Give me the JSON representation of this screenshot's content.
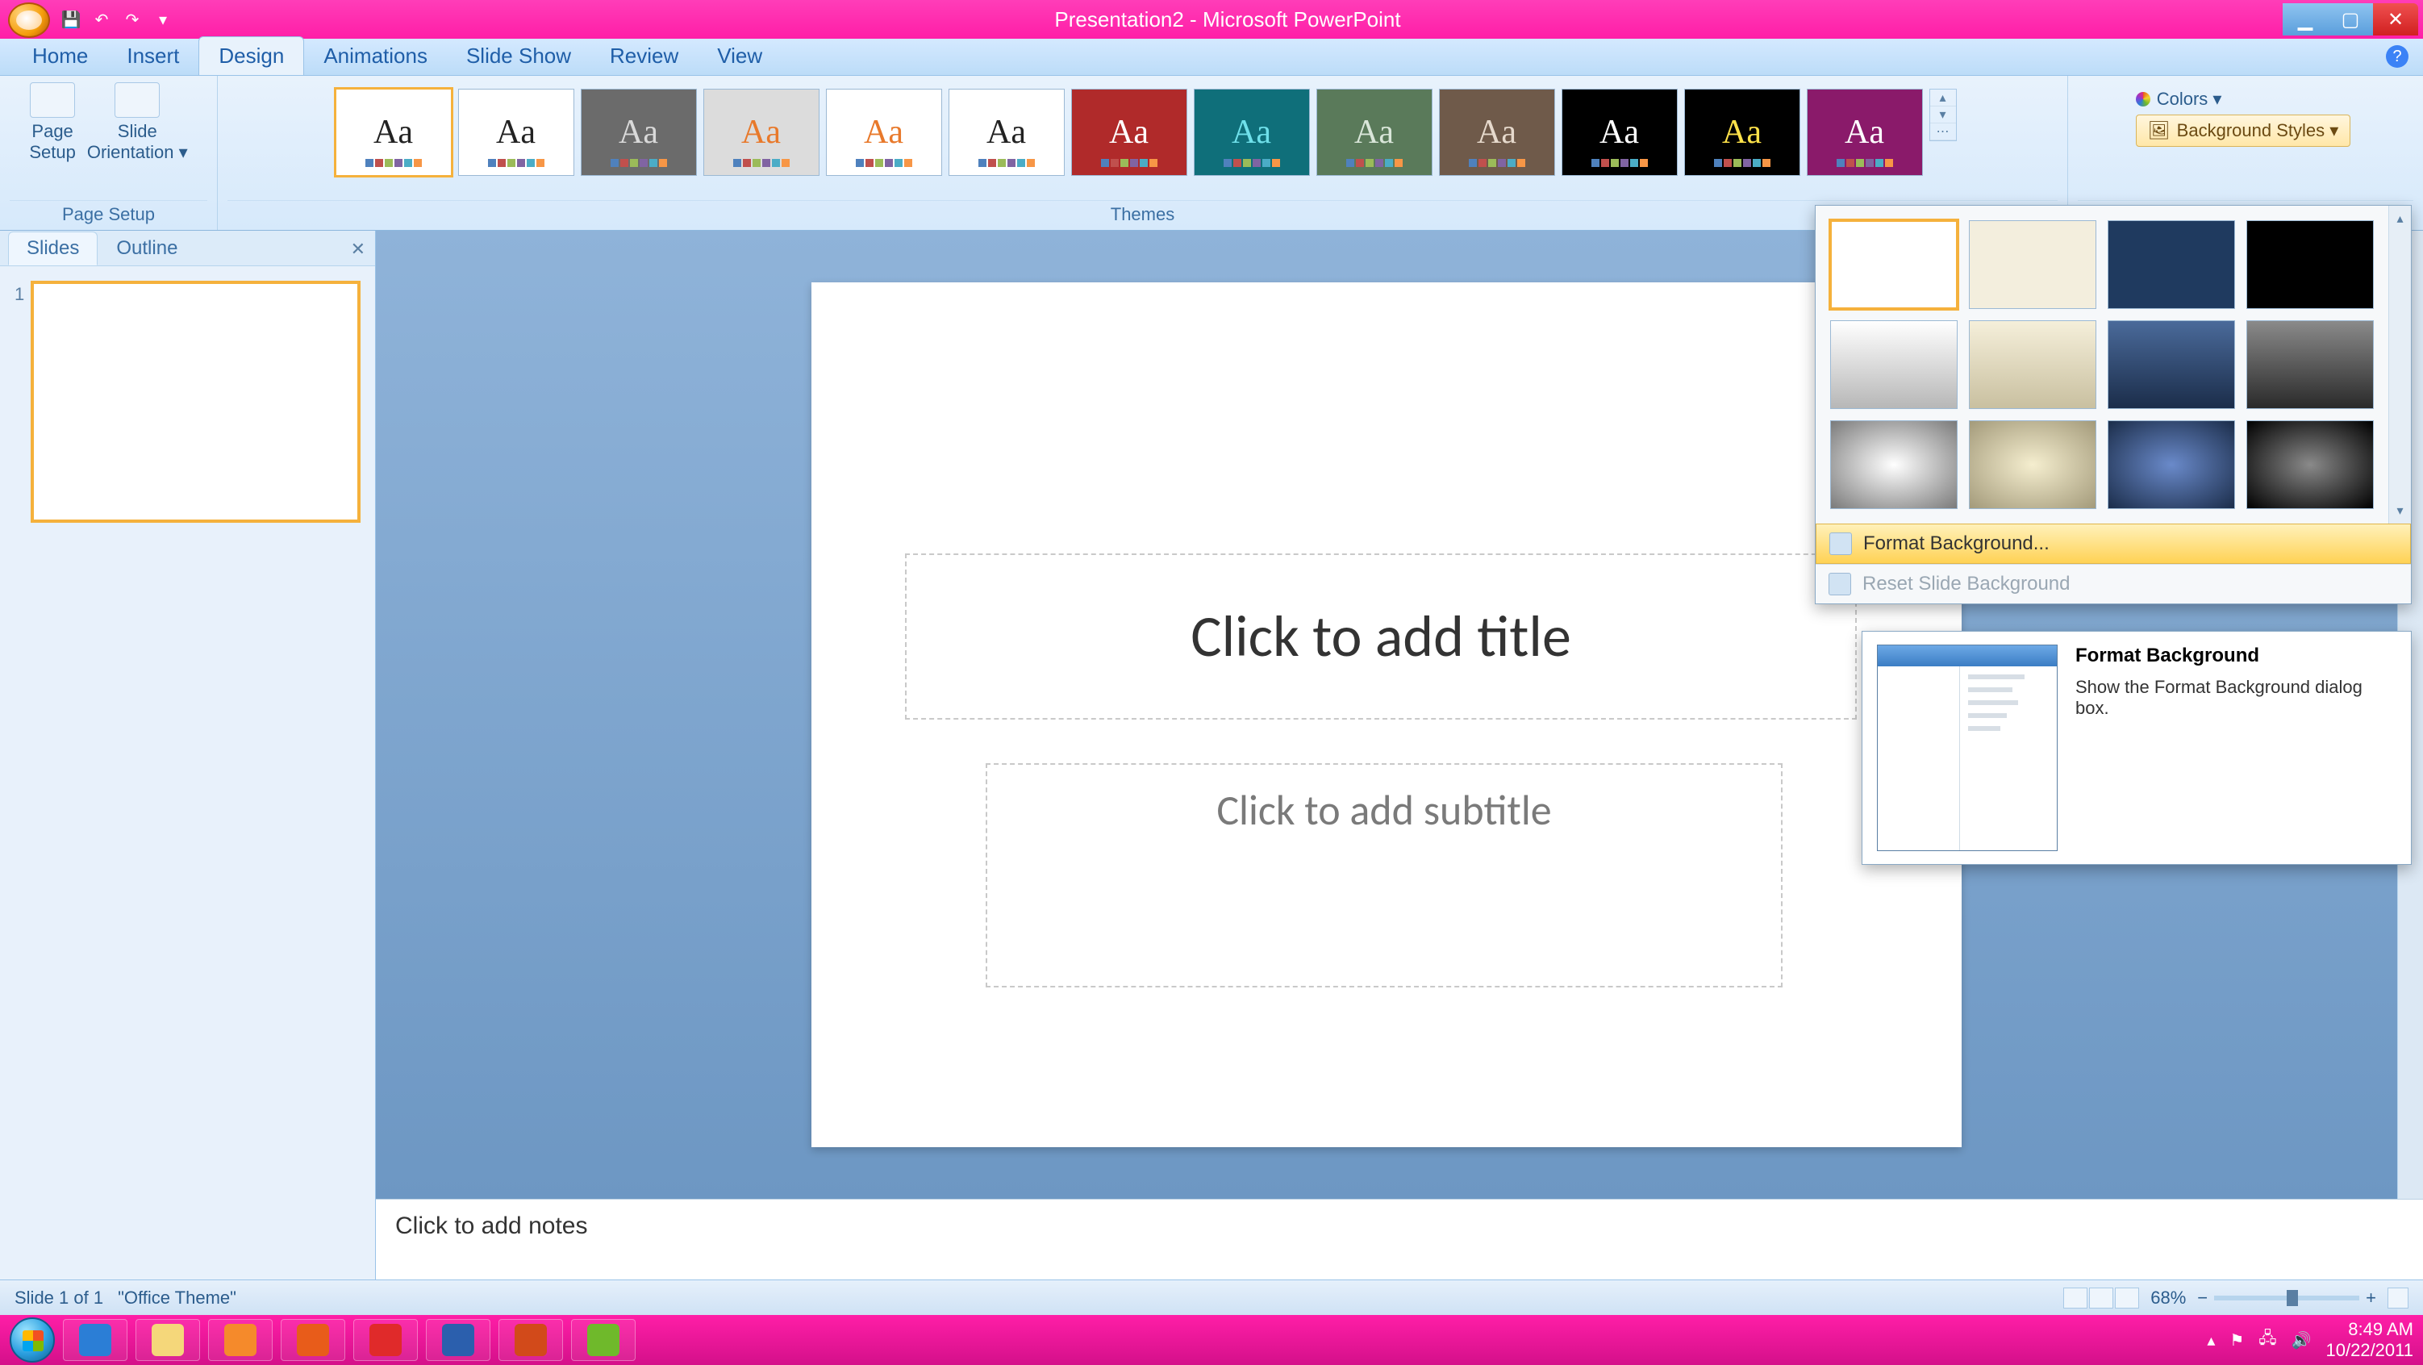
{
  "title": "Presentation2 - Microsoft PowerPoint",
  "tabs": [
    "Home",
    "Insert",
    "Design",
    "Animations",
    "Slide Show",
    "Review",
    "View"
  ],
  "active_tab_index": 2,
  "groups": {
    "page_setup": {
      "label": "Page Setup",
      "buttons": {
        "page_setup": "Page\nSetup",
        "orientation": "Slide\nOrientation ▾"
      }
    },
    "themes": {
      "label": "Themes"
    }
  },
  "theme_controls": {
    "colors": "Colors ▾",
    "bg_styles": "Background Styles ▾"
  },
  "themes": [
    {
      "bg": "#ffffff",
      "fg": "#222222",
      "name": "office"
    },
    {
      "bg": "#ffffff",
      "fg": "#222222",
      "name": "apex"
    },
    {
      "bg": "#6b6b6b",
      "fg": "#d9d9d9",
      "name": "aspect"
    },
    {
      "bg": "#dcdcdc",
      "fg": "#e8792b",
      "name": "civic"
    },
    {
      "bg": "#ffffff",
      "fg": "#e8792b",
      "name": "concourse"
    },
    {
      "bg": "#ffffff",
      "fg": "#222222",
      "name": "equity"
    },
    {
      "bg": "#b02a2a",
      "fg": "#ffffff",
      "name": "flow"
    },
    {
      "bg": "#0f6f7a",
      "fg": "#6fe0ea",
      "name": "foundry"
    },
    {
      "bg": "#5a7a5a",
      "fg": "#d9e6d9",
      "name": "median"
    },
    {
      "bg": "#6f5a4a",
      "fg": "#e6d9cc",
      "name": "metro"
    },
    {
      "bg": "#000000",
      "fg": "#ffffff",
      "name": "module"
    },
    {
      "bg": "#000000",
      "fg": "#ffe24a",
      "name": "opulent"
    },
    {
      "bg": "#8a1a6a",
      "fg": "#ffffff",
      "name": "oriel"
    }
  ],
  "swatches": [
    "#4f81bd",
    "#c0504d",
    "#9bbb59",
    "#8064a2",
    "#4bacc6",
    "#f79646"
  ],
  "bg_panel": {
    "styles": [
      {
        "bg": "#ffffff"
      },
      {
        "bg": "#f3eedd"
      },
      {
        "bg": "#1f3a5f"
      },
      {
        "bg": "#000000"
      },
      {
        "bg": "linear-gradient(#ffffff,#b7b7b7)"
      },
      {
        "bg": "linear-gradient(#f5efda,#c9c0a0)"
      },
      {
        "bg": "linear-gradient(#4a6a9a,#1b2d4a)"
      },
      {
        "bg": "linear-gradient(#8a8a8a,#2a2a2a)"
      },
      {
        "bg": "radial-gradient(#ffffff,#7a7a7a)"
      },
      {
        "bg": "radial-gradient(#f5eecf,#a39a7a)"
      },
      {
        "bg": "radial-gradient(#6a8aca,#1b2d4a)"
      },
      {
        "bg": "radial-gradient(#8a8a8a,#000000)"
      }
    ],
    "format_bg": "Format Background...",
    "reset_bg": "Reset Slide Background"
  },
  "tooltip": {
    "title": "Format Background",
    "body": "Show the Format Background dialog box."
  },
  "slide_panel": {
    "tabs": [
      "Slides",
      "Outline"
    ],
    "active": 0
  },
  "slide": {
    "title_placeholder": "Click to add title",
    "subtitle_placeholder": "Click to add subtitle"
  },
  "notes_placeholder": "Click to add notes",
  "status": {
    "slide": "Slide 1 of 1",
    "theme": "\"Office Theme\"",
    "zoom": "68%"
  },
  "taskbar": {
    "apps": [
      {
        "name": "ie",
        "bg": "#2b7ed6"
      },
      {
        "name": "explorer",
        "bg": "#f5d77a"
      },
      {
        "name": "media",
        "bg": "#f58a2b"
      },
      {
        "name": "firefox",
        "bg": "#e85c1a"
      },
      {
        "name": "skype",
        "bg": "#e02a2a"
      },
      {
        "name": "word",
        "bg": "#2b5fad"
      },
      {
        "name": "powerpoint",
        "bg": "#d24a1a"
      },
      {
        "name": "other",
        "bg": "#6fb92b"
      }
    ],
    "time": "8:49 AM",
    "date": "10/22/2011"
  }
}
